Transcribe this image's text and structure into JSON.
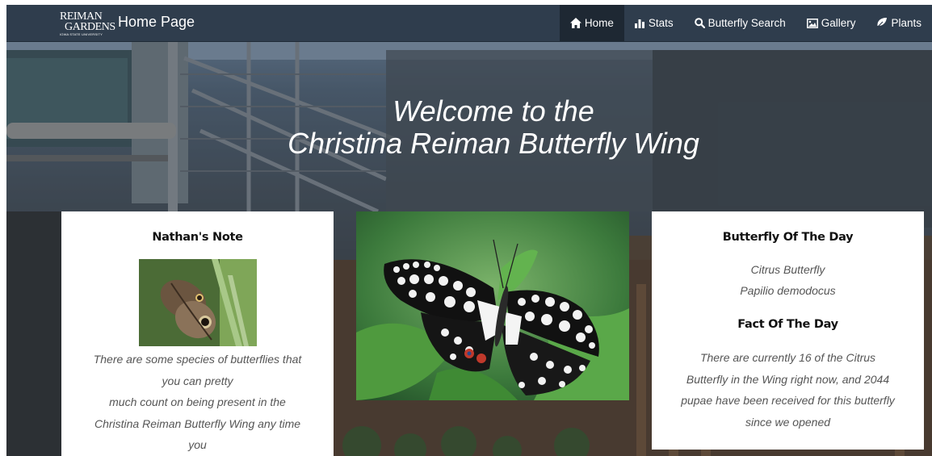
{
  "navbar": {
    "logo": {
      "line1": "REIMAN",
      "line2": "GARDENS",
      "line3": "IOWA STATE UNIVERSITY"
    },
    "title": "Home Page",
    "items": [
      {
        "label": "Home",
        "icon": "home-icon",
        "active": true
      },
      {
        "label": "Stats",
        "icon": "bar-chart-icon",
        "active": false
      },
      {
        "label": "Butterfly Search",
        "icon": "search-icon",
        "active": false
      },
      {
        "label": "Gallery",
        "icon": "picture-icon",
        "active": false
      },
      {
        "label": "Plants",
        "icon": "leaf-icon",
        "active": false
      }
    ]
  },
  "hero": {
    "title_line1": "Welcome to the",
    "title_line2": "Christina Reiman Butterfly Wing"
  },
  "note": {
    "title": "Nathan's Note",
    "lines": [
      "There are some species of butterflies that",
      "you can pretty",
      "much count on being present in the",
      "Christina Reiman Butterfly Wing any time",
      "you"
    ]
  },
  "butterfly_of_day": {
    "title": "Butterfly Of The Day",
    "common_name": "Citrus Butterfly",
    "scientific_name": "Papilio demodocus",
    "fact_title": "Fact Of The Day",
    "fact_lines": [
      "There are currently 16 of the Citrus",
      "Butterfly in the Wing right now, and 2044",
      "pupae have been received for this butterfly",
      "since we opened"
    ]
  },
  "colors": {
    "navbar": "#2f3d4d",
    "navbar_active": "#1e2833",
    "card_bg": "#ffffff",
    "body_text": "#555555"
  }
}
